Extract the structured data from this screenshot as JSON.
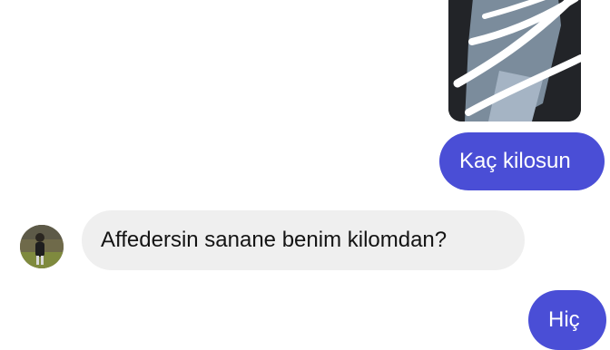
{
  "conversation": {
    "messages": [
      {
        "sender": "me",
        "text": "Kaç kilosun"
      },
      {
        "sender": "contact",
        "text": "Affedersin sanane benim kilomdan?"
      },
      {
        "sender": "me",
        "text": "Hiç"
      }
    ]
  },
  "colors": {
    "outgoing_bubble": "#4a4ed6",
    "incoming_bubble": "#efefef",
    "background": "#ffffff"
  },
  "icons": {
    "avatar": "contact-avatar-photo",
    "shared_photo": "shared-photo-thumbnail"
  }
}
